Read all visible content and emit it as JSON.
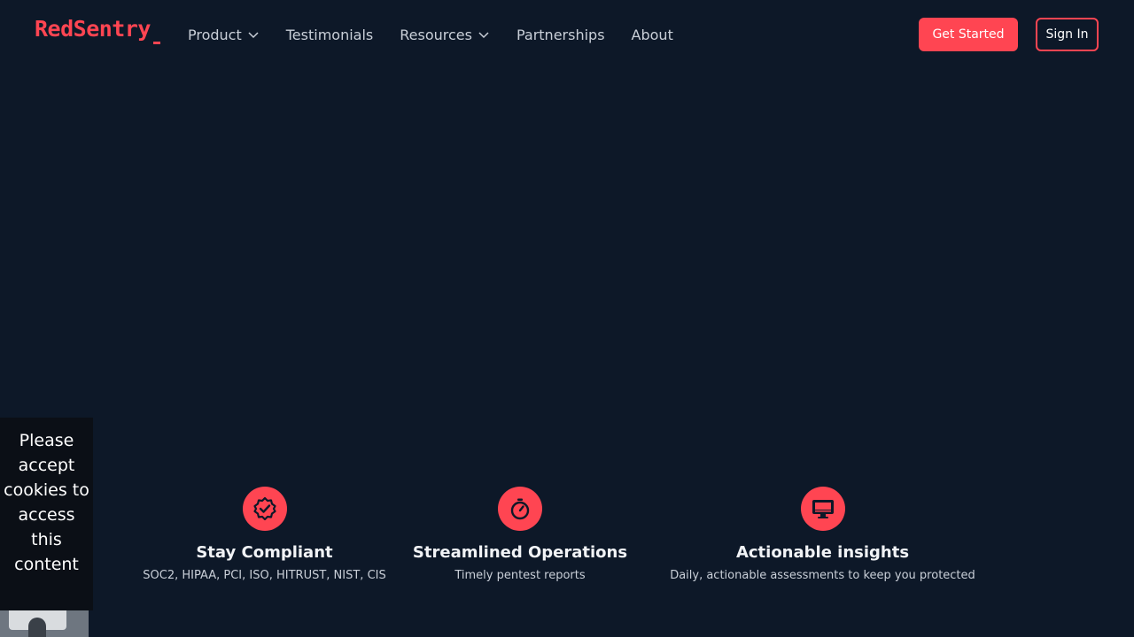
{
  "brand": {
    "logo_text": "RedSentry",
    "accent": "#ff4552"
  },
  "nav": {
    "items": [
      {
        "label": "Product",
        "has_dropdown": true
      },
      {
        "label": "Testimonials",
        "has_dropdown": false
      },
      {
        "label": "Resources",
        "has_dropdown": true
      },
      {
        "label": "Partnerships",
        "has_dropdown": false
      },
      {
        "label": "About",
        "has_dropdown": false
      }
    ]
  },
  "header": {
    "get_started_label": "Get Started",
    "sign_in_label": "Sign In"
  },
  "features": [
    {
      "icon": "badge-check-icon",
      "title": "Stay Compliant",
      "desc": "SOC2, HIPAA, PCI, ISO, HITRUST, NIST, CIS"
    },
    {
      "icon": "stopwatch-icon",
      "title": "Streamlined Operations",
      "desc": "Timely pentest reports"
    },
    {
      "icon": "monitor-icon",
      "title": "Actionable insights",
      "desc": "Daily, actionable assessments to keep you protected"
    }
  ],
  "cookie_notice": {
    "text": "Please accept cookies to access this content"
  }
}
